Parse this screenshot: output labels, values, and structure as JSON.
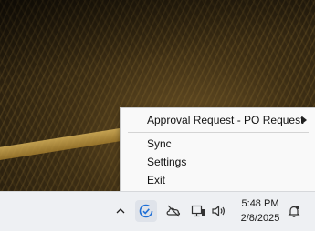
{
  "context_menu": {
    "items": [
      {
        "label": "Approval Request - PO Request",
        "has_submenu": true
      },
      {
        "label": "Sync"
      },
      {
        "label": "Settings"
      },
      {
        "label": "Exit"
      }
    ]
  },
  "taskbar": {
    "tray_icons": [
      "chevron-up-icon",
      "checkmark-circle-app-icon",
      "onedrive-offline-icon",
      "network-monitor-icon",
      "volume-icon",
      "notification-bell-icon"
    ],
    "clock": {
      "time": "5:48 PM",
      "date": "2/8/2025"
    }
  },
  "colors": {
    "accent": "#1f6fd6",
    "taskbar": "#eef0f3",
    "menu": "#f9f9f9"
  }
}
